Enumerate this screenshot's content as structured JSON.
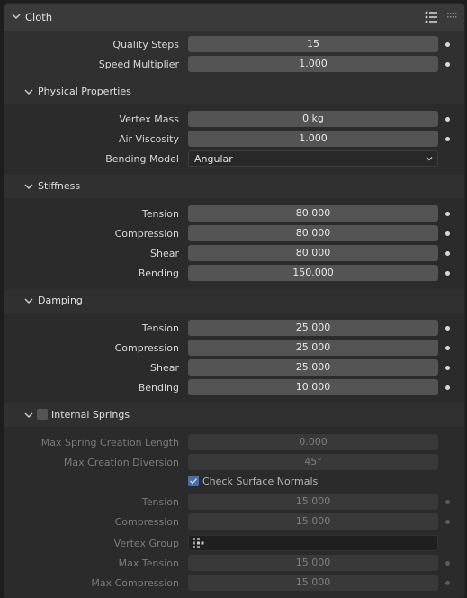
{
  "panel": {
    "title": "Cloth"
  },
  "general": {
    "quality_steps": {
      "label": "Quality Steps",
      "value": "15"
    },
    "speed_multiplier": {
      "label": "Speed Multiplier",
      "value": "1.000"
    }
  },
  "physical": {
    "title": "Physical Properties",
    "vertex_mass": {
      "label": "Vertex Mass",
      "value": "0 kg"
    },
    "air_viscosity": {
      "label": "Air Viscosity",
      "value": "1.000"
    },
    "bending_model": {
      "label": "Bending Model",
      "value": "Angular"
    }
  },
  "stiffness": {
    "title": "Stiffness",
    "tension": {
      "label": "Tension",
      "value": "80.000"
    },
    "compression": {
      "label": "Compression",
      "value": "80.000"
    },
    "shear": {
      "label": "Shear",
      "value": "80.000"
    },
    "bending": {
      "label": "Bending",
      "value": "150.000"
    }
  },
  "damping": {
    "title": "Damping",
    "tension": {
      "label": "Tension",
      "value": "25.000"
    },
    "compression": {
      "label": "Compression",
      "value": "25.000"
    },
    "shear": {
      "label": "Shear",
      "value": "25.000"
    },
    "bending": {
      "label": "Bending",
      "value": "10.000"
    }
  },
  "internal_springs": {
    "title": "Internal Springs",
    "enabled": false,
    "max_spring_creation_length": {
      "label": "Max Spring Creation Length",
      "value": "0.000"
    },
    "max_creation_diversion": {
      "label": "Max Creation Diversion",
      "value": "45°"
    },
    "check_surface_normals": {
      "label": "Check Surface Normals",
      "checked": true
    },
    "tension": {
      "label": "Tension",
      "value": "15.000"
    },
    "compression": {
      "label": "Compression",
      "value": "15.000"
    },
    "vertex_group": {
      "label": "Vertex Group",
      "value": ""
    },
    "max_tension": {
      "label": "Max Tension",
      "value": "15.000"
    },
    "max_compression": {
      "label": "Max Compression",
      "value": "15.000"
    }
  },
  "icons": {
    "collapse": "chevron-down-icon",
    "presets": "list-icon",
    "drag": "grip-icon",
    "vertex_group": "vertex-group-icon",
    "keyframe": "dot-icon"
  },
  "colors": {
    "panel_bg": "#303030",
    "field_bg": "#545454",
    "checkbox_accent": "#4a6ea8"
  }
}
